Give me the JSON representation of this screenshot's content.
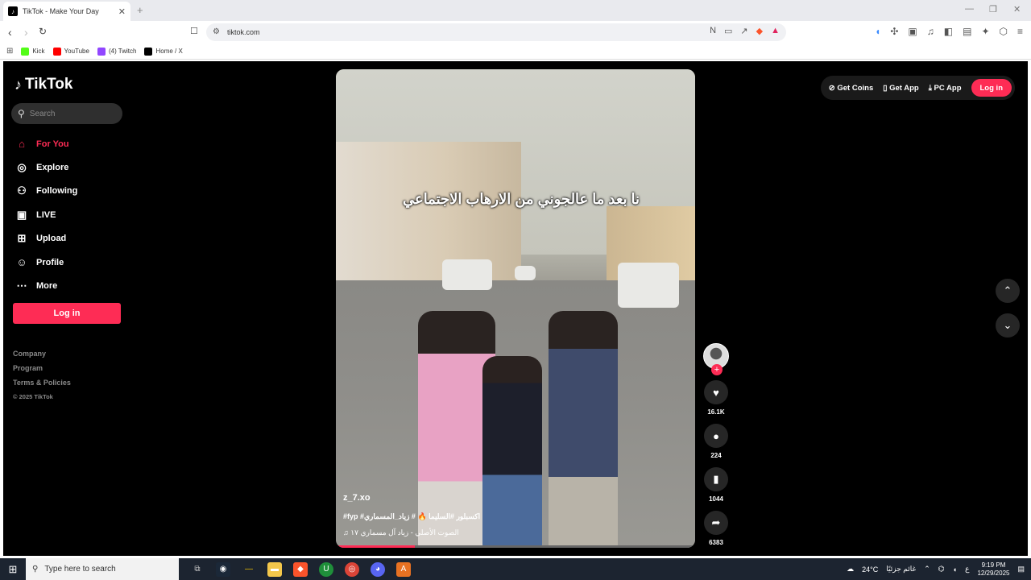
{
  "browser": {
    "tab_title": "TikTok - Make Your Day",
    "url": "tiktok.com",
    "bookmarks": [
      {
        "label": "Kick",
        "color": "#53fc18"
      },
      {
        "label": "YouTube",
        "color": "#ff0000"
      },
      {
        "label": "(4) Twitch",
        "color": "#9146ff"
      },
      {
        "label": "Home / X",
        "color": "#000000"
      }
    ]
  },
  "sidebar": {
    "logo": "TikTok",
    "search_placeholder": "Search",
    "items": [
      {
        "label": "For You",
        "icon": "home-icon"
      },
      {
        "label": "Explore",
        "icon": "compass-icon"
      },
      {
        "label": "Following",
        "icon": "following-icon"
      },
      {
        "label": "LIVE",
        "icon": "live-icon"
      },
      {
        "label": "Upload",
        "icon": "upload-icon"
      },
      {
        "label": "Profile",
        "icon": "profile-icon"
      },
      {
        "label": "More",
        "icon": "more-icon"
      }
    ],
    "login_label": "Log in",
    "footer": [
      "Company",
      "Program",
      "Terms & Policies"
    ],
    "copyright": "© 2025 TikTok"
  },
  "header": {
    "get_coins": "Get Coins",
    "get_app": "Get App",
    "pc_app": "PC App",
    "login": "Log in"
  },
  "video": {
    "caption": "نا بعد ما عالجوني من الارهاب الاجتماعي",
    "username": "z_7.xo",
    "tags": "#fyp #اكسبلور #السليما 🔥 # زياد_المسماري",
    "sound": "الصوت الأصلي - زياد آل مسماري ١٧",
    "progress": 0.22,
    "likes": "16.1K",
    "comments": "224",
    "saves": "1044",
    "shares": "6383"
  },
  "taskbar": {
    "search_placeholder": "Type here to search",
    "weather": "24°C",
    "weather_text": "غائم جزئيًا",
    "lang": "ع",
    "time": "9:19 PM",
    "date": "12/29/2025"
  },
  "colors": {
    "accent": "#fe2c55",
    "page_bg": "#000000"
  }
}
